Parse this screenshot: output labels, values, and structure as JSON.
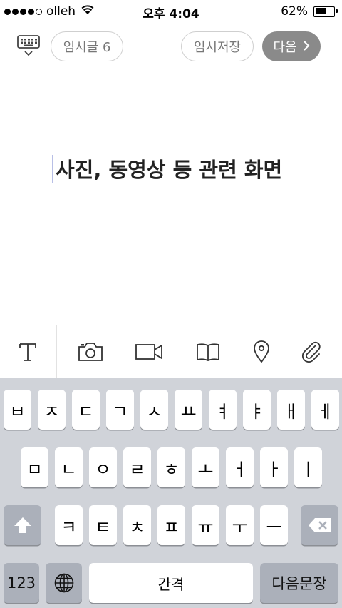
{
  "status_bar": {
    "carrier": "olleh",
    "time": "오후 4:04",
    "battery_text": "62%",
    "battery_level": 0.62
  },
  "toolbar": {
    "drafts_label": "임시글 6",
    "save_label": "임시저장",
    "next_label": "다음"
  },
  "editor": {
    "content": "사진, 동영상 등 관련 화면"
  },
  "attach_bar": {
    "items": [
      "text-icon",
      "camera-icon",
      "video-icon",
      "book-icon",
      "location-pin-icon",
      "paperclip-icon"
    ]
  },
  "keyboard": {
    "row1": [
      "ㅂ",
      "ㅈ",
      "ㄷ",
      "ㄱ",
      "ㅅ",
      "ㅛ",
      "ㅕ",
      "ㅑ",
      "ㅐ",
      "ㅔ"
    ],
    "row2": [
      "ㅁ",
      "ㄴ",
      "ㅇ",
      "ㄹ",
      "ㅎ",
      "ㅗ",
      "ㅓ",
      "ㅏ",
      "ㅣ"
    ],
    "row3": [
      "ㅋ",
      "ㅌ",
      "ㅊ",
      "ㅍ",
      "ㅠ",
      "ㅜ",
      "ㅡ"
    ],
    "numbers_label": "123",
    "space_label": "간격",
    "return_label": "다음문장"
  },
  "colors": {
    "next_button": "#8a8a8a",
    "keyboard_bg": "#d0d3d9",
    "function_key": "#abb0ba",
    "caret": "#b8bfe6"
  }
}
